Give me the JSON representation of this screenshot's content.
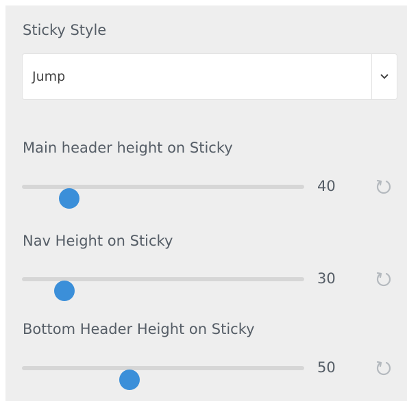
{
  "sticky_style": {
    "label": "Sticky Style",
    "selected": "Jump",
    "dropdown_icon": "chevron-down-icon"
  },
  "sliders": [
    {
      "label": "Main header height on Sticky",
      "value": "40",
      "level": 0.167,
      "reset_icon": "reset-icon"
    },
    {
      "label": "Nav Height on Sticky",
      "value": "30",
      "level": 0.151,
      "reset_icon": "reset-icon"
    },
    {
      "label": "Bottom Header Height on Sticky",
      "value": "50",
      "level": 0.381,
      "reset_icon": "reset-icon"
    }
  ],
  "colors": {
    "panel_background": "#eeeeee",
    "slider_thumb": "#3b8fd9",
    "slider_track": "#d6d6d6",
    "text": "#555d66",
    "reset_icon": "#b4b9be"
  }
}
